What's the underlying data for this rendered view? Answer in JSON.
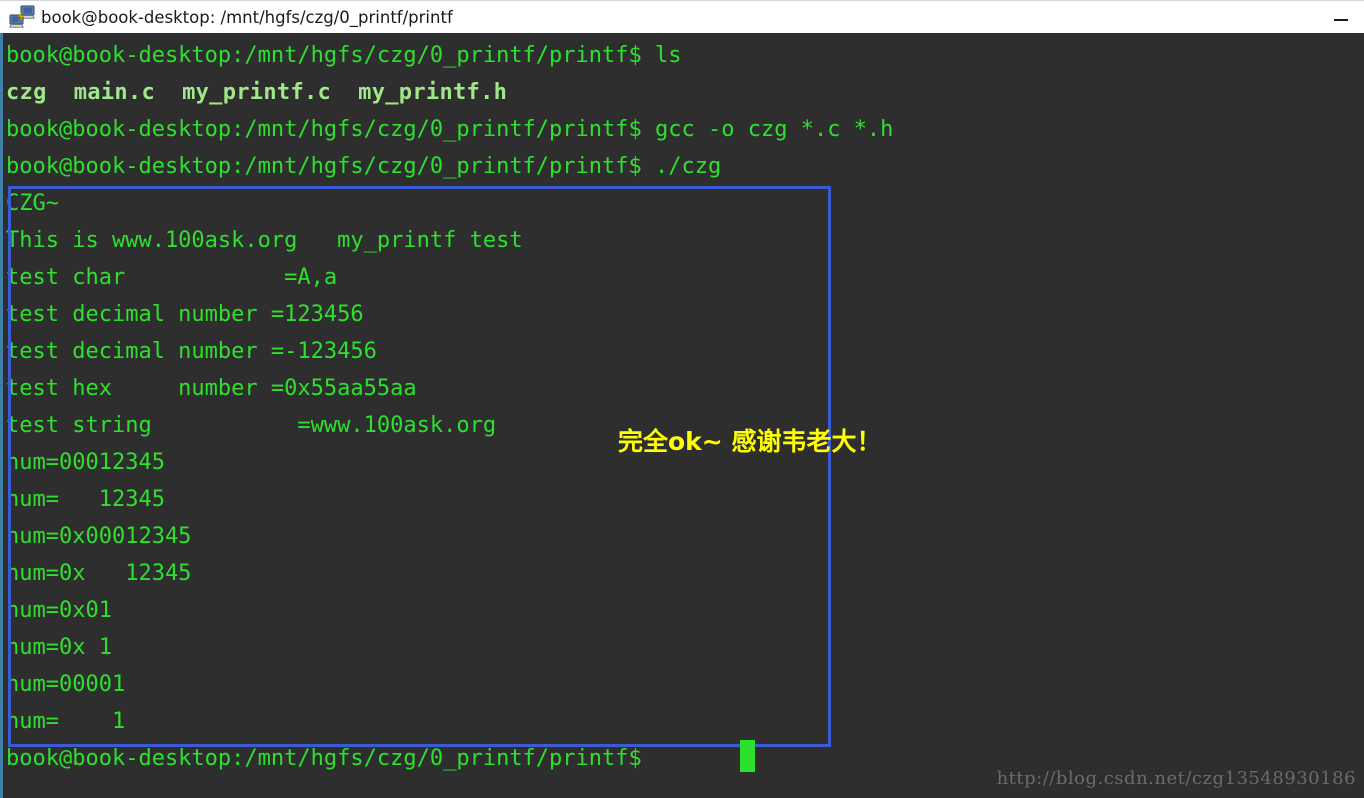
{
  "window": {
    "title": "book@book-desktop: /mnt/hgfs/czg/0_printf/printf",
    "icon": "putty-network-icon",
    "minimize_label": "—",
    "titlebar_bg": "#ffffff",
    "terminal_bg": "#2e2e2e"
  },
  "terminal": {
    "prompt": "book@book-desktop:/mnt/hgfs/czg/0_printf/printf$ ",
    "colors": {
      "prompt_green": "#2ee02e",
      "ls_green": "#9fe88a",
      "annotation_blue": "#3b5bd6",
      "annotation_yellow": "#ffff00",
      "watermark_gray": "#6b6b6b"
    },
    "lines": [
      {
        "type": "prompt",
        "text": "book@book-desktop:/mnt/hgfs/czg/0_printf/printf$ ls"
      },
      {
        "type": "lsout",
        "text": "czg  main.c  my_printf.c  my_printf.h"
      },
      {
        "type": "prompt",
        "text": "book@book-desktop:/mnt/hgfs/czg/0_printf/printf$ gcc -o czg *.c *.h"
      },
      {
        "type": "prompt",
        "text": "book@book-desktop:/mnt/hgfs/czg/0_printf/printf$ ./czg"
      },
      {
        "type": "out",
        "text": "CZG~"
      },
      {
        "type": "out",
        "text": "This is www.100ask.org   my_printf test"
      },
      {
        "type": "out",
        "text": "test char            =A,a"
      },
      {
        "type": "out",
        "text": "test decimal number =123456"
      },
      {
        "type": "out",
        "text": "test decimal number =-123456"
      },
      {
        "type": "out",
        "text": "test hex     number =0x55aa55aa"
      },
      {
        "type": "out",
        "text": "test string           =www.100ask.org"
      },
      {
        "type": "out",
        "text": "num=00012345"
      },
      {
        "type": "out",
        "text": "num=   12345"
      },
      {
        "type": "out",
        "text": "num=0x00012345"
      },
      {
        "type": "out",
        "text": "num=0x   12345"
      },
      {
        "type": "out",
        "text": "num=0x01"
      },
      {
        "type": "out",
        "text": "num=0x 1"
      },
      {
        "type": "out",
        "text": "num=00001"
      },
      {
        "type": "out",
        "text": "num=    1"
      },
      {
        "type": "prompt",
        "text": "book@book-desktop:/mnt/hgfs/czg/0_printf/printf$ "
      }
    ]
  },
  "annotations": {
    "highlight_box_label": "output-highlight-box",
    "note": "完全ok~ 感谢韦老大！"
  },
  "watermark": {
    "text": "http://blog.csdn.net/czg13548930186"
  }
}
